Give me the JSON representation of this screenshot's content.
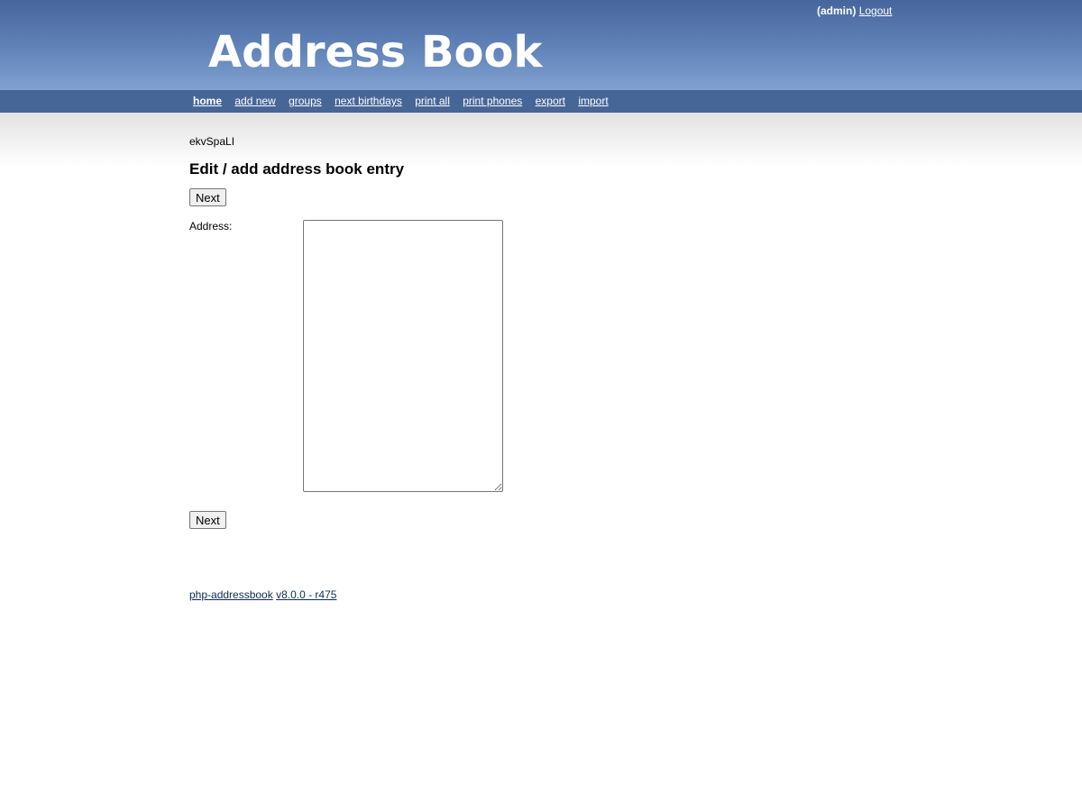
{
  "header": {
    "username": "(admin)",
    "logout_label": "Logout",
    "logo_text": "Address Book"
  },
  "nav": {
    "items": [
      {
        "label": "home"
      },
      {
        "label": "add new"
      },
      {
        "label": "groups"
      },
      {
        "label": "next birthdays"
      },
      {
        "label": "print all"
      },
      {
        "label": "print phones"
      },
      {
        "label": "export"
      },
      {
        "label": "import"
      }
    ]
  },
  "main": {
    "group_name": "ekvSpaLI",
    "title": "Edit / add address book entry",
    "next_button_label": "Next",
    "address_label": "Address:",
    "address_value": ""
  },
  "footer": {
    "project_link": "php-addressbook",
    "version_link": "v8.0.0 - r475"
  },
  "colors": {
    "header_top": "#46659d",
    "header_bottom": "#80a1d0",
    "navbar": "#476698",
    "footer_link": "#0d2c53"
  }
}
